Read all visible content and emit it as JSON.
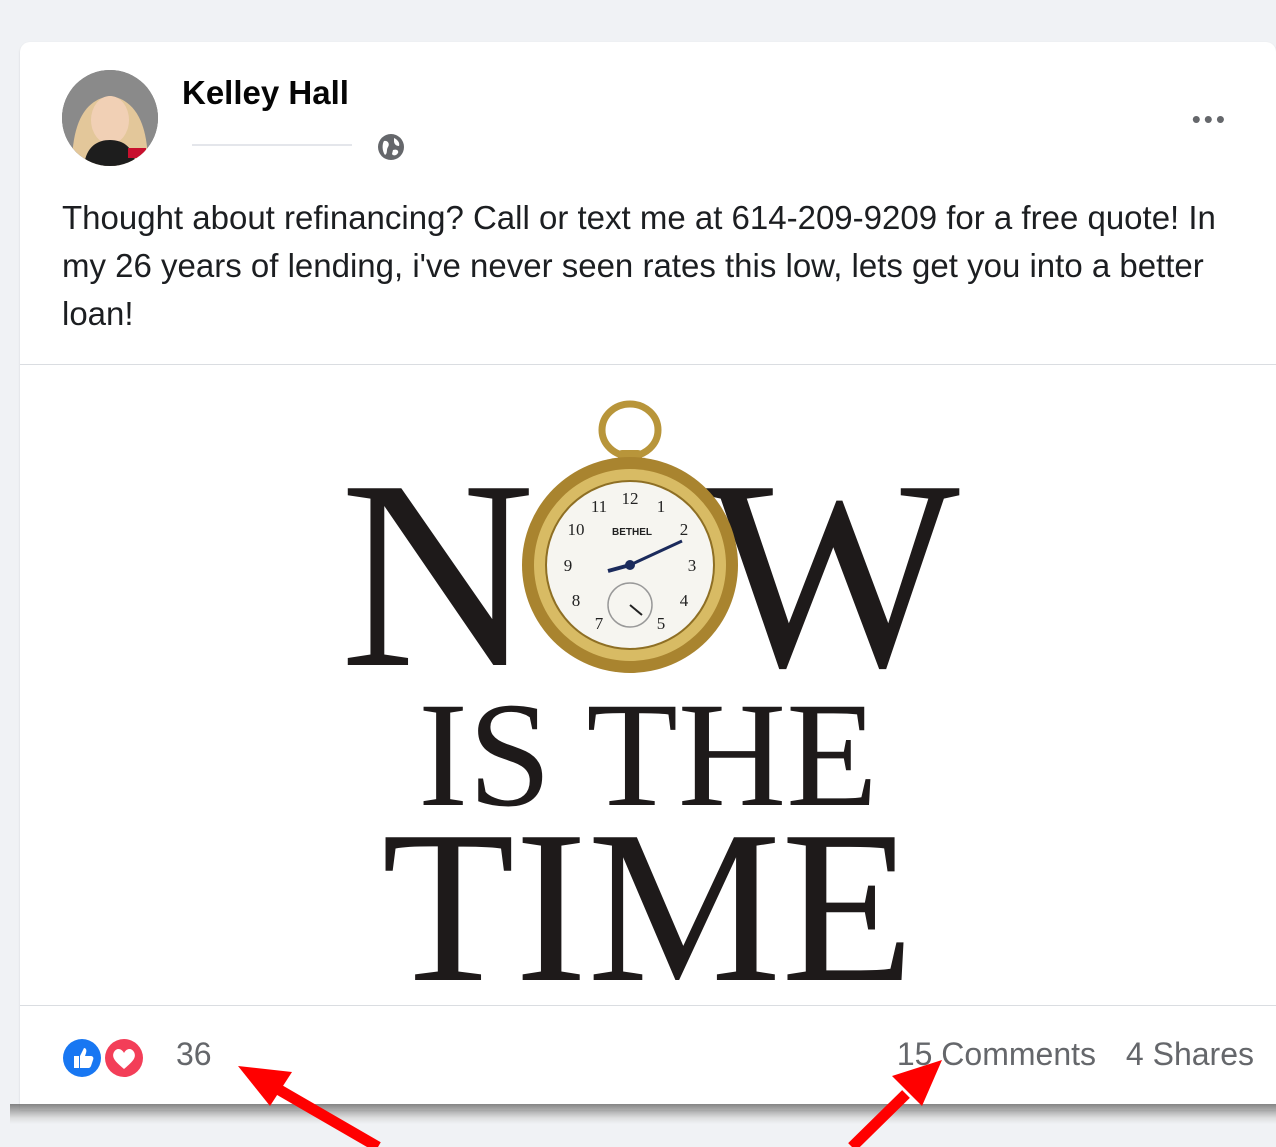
{
  "post": {
    "author": "Kelley Hall",
    "privacy_icon": "globe-icon",
    "more_label": "•••",
    "text": "Thought about refinancing? Call or text me at 614-209-9209 for a free quote! In my 26 years of lending, i've never seen rates this low, lets get you into a better loan!",
    "image": {
      "line1_left": "N",
      "line1_right": "W",
      "line2": "IS THE",
      "line3": "TIME",
      "watch_brand": "BETHEL"
    },
    "stats": {
      "reaction_count": "36",
      "comments_label": "15 Comments",
      "shares_label": "4 Shares",
      "reactions": [
        "like-icon",
        "love-icon"
      ]
    }
  },
  "colors": {
    "like": "#1877f2",
    "love": "#f33e58",
    "arrow": "#ff0000",
    "muted_text": "#65676b"
  }
}
